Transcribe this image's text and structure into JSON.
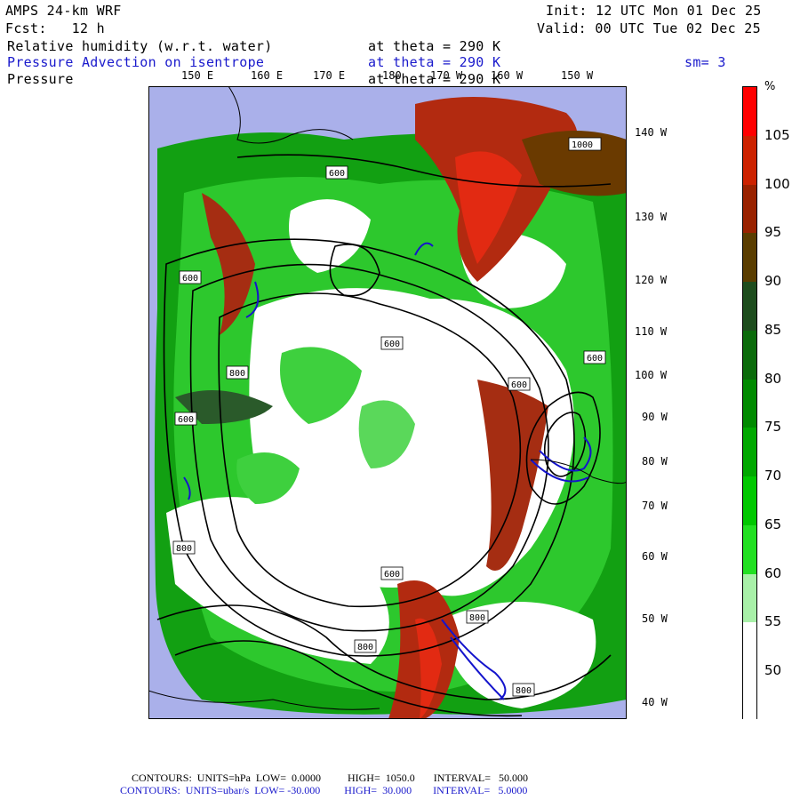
{
  "header": {
    "model": "AMPS 24-km WRF",
    "forecast": "Fcst:   12 h",
    "init": "Init: 12 UTC Mon 01 Dec 25",
    "valid": "Valid: 00 UTC Tue 02 Dec 25"
  },
  "fields": [
    {
      "name": "Relative humidity (w.r.t. water)",
      "level": "at theta = 290 K",
      "color": "#000000"
    },
    {
      "name": "Pressure Advection on isentrope",
      "level": "at theta = 290 K",
      "color": "#1a1acc"
    },
    {
      "name": "Pressure",
      "level": "at theta = 290 K",
      "color": "#000000"
    }
  ],
  "smoothing": "sm= 3",
  "longitude_labels_top": [
    "150 E",
    "160 E",
    "170 E",
    "180",
    "170 W",
    "160 W",
    "150 W"
  ],
  "latitude_labels_right": [
    "140 W",
    "130 W",
    "120 W",
    "110 W",
    "100 W",
    "90 W",
    "80 W",
    "70 W",
    "60 W",
    "50 W",
    "40 W"
  ],
  "contour_labels": [
    "1000",
    "600",
    "600",
    "600",
    "600",
    "600",
    "800",
    "600",
    "800",
    "600",
    "800",
    "800",
    "800"
  ],
  "colorbar": {
    "unit": "%",
    "labels": [
      "105",
      "100",
      "95",
      "90",
      "85",
      "80",
      "75",
      "70",
      "65",
      "60",
      "55",
      "50"
    ],
    "colors": [
      "#ff0000",
      "#cc2200",
      "#992200",
      "#5a3d00",
      "#1e4d1e",
      "#0b6b0b",
      "#008a00",
      "#00a800",
      "#00c800",
      "#22e022",
      "#a8f0a8",
      "#ffffff",
      "#ffffff"
    ]
  },
  "footer": {
    "line1": "CONTOURS:  UNITS=hPa  LOW=  0.0000          HIGH=  1050.0       INTERVAL=   50.000",
    "line2": "CONTOURS:  UNITS=ubar/s  LOW= -30.000         HIGH=  30.000        INTERVAL=   5.0000",
    "line1_color": "#000000",
    "line2_color": "#1a1acc"
  }
}
